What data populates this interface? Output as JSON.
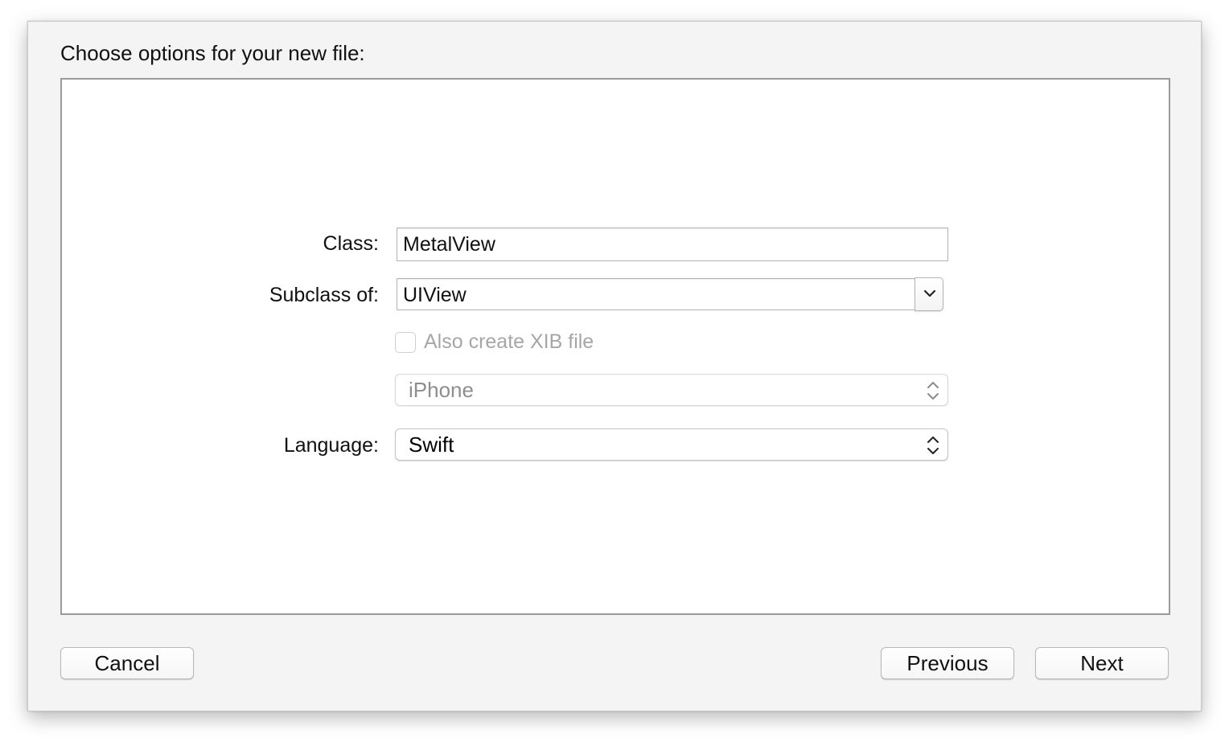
{
  "dialog": {
    "title": "Choose options for your new file:"
  },
  "form": {
    "class_label": "Class:",
    "class_value": "MetalView",
    "subclass_label": "Subclass of:",
    "subclass_value": "UIView",
    "xib_checkbox_label": "Also create XIB file",
    "xib_checked": false,
    "device_value": "iPhone",
    "language_label": "Language:",
    "language_value": "Swift"
  },
  "buttons": {
    "cancel": "Cancel",
    "previous": "Previous",
    "next": "Next"
  },
  "icons": {
    "combo_dropdown": "chevron-down-icon",
    "popup_stepper": "up-down-arrows-icon"
  }
}
